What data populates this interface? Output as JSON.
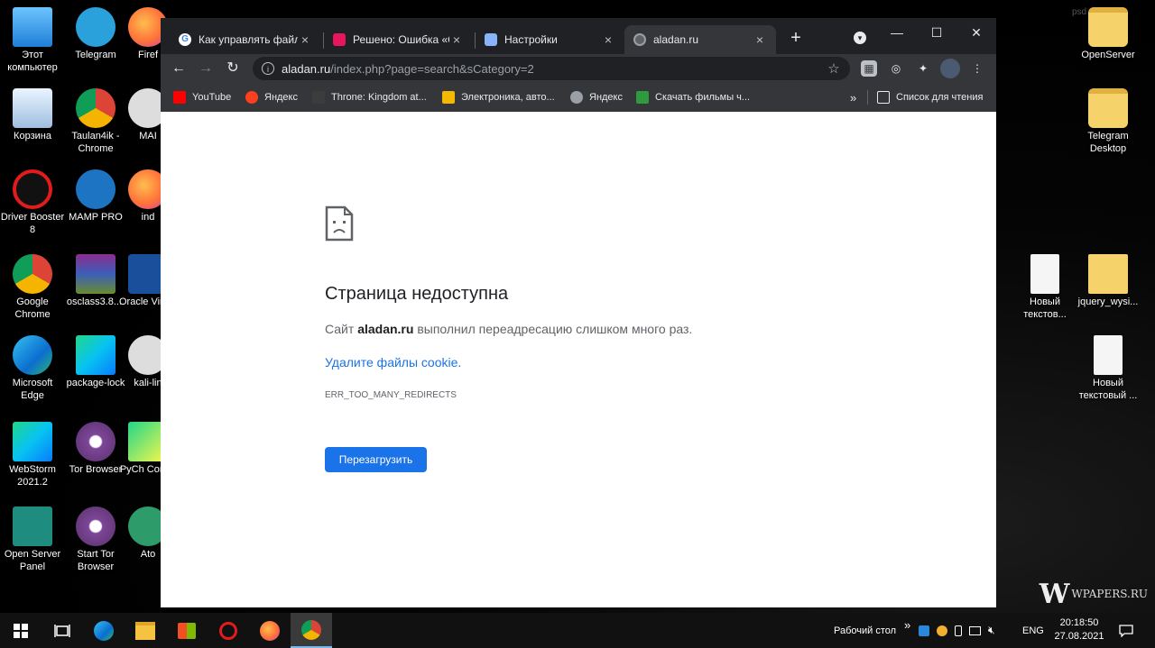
{
  "desktop": {
    "left_icons": [
      {
        "label": "Этот компьютер",
        "icon": "computer-icon"
      },
      {
        "label": "Telegram",
        "icon": "telegram-icon"
      },
      {
        "label": "Firef",
        "icon": "firefox-icon"
      },
      {
        "label": "Корзина",
        "icon": "recycle-bin-icon"
      },
      {
        "label": "Taulan4ik - Chrome",
        "icon": "chrome-profile-icon"
      },
      {
        "label": "MAI",
        "icon": "mamp-icon"
      },
      {
        "label": "Driver Booster 8",
        "icon": "driver-booster-icon"
      },
      {
        "label": "MAMP PRO",
        "icon": "mamp-pro-icon"
      },
      {
        "label": "ind",
        "icon": "firefox-icon"
      },
      {
        "label": "Google Chrome",
        "icon": "chrome-icon"
      },
      {
        "label": "osclass3.8....",
        "icon": "winrar-icon"
      },
      {
        "label": "Oracle Virtua",
        "icon": "virtualbox-icon"
      },
      {
        "label": "Microsoft Edge",
        "icon": "edge-icon"
      },
      {
        "label": "package-lock",
        "icon": "webstorm-icon"
      },
      {
        "label": "kali-lin",
        "icon": "kali-icon"
      },
      {
        "label": "WebStorm 2021.2",
        "icon": "webstorm-icon"
      },
      {
        "label": "Tor Browser",
        "icon": "tor-icon"
      },
      {
        "label": "PyCh Comm",
        "icon": "pycharm-icon"
      },
      {
        "label": "Open Server Panel",
        "icon": "terminal-icon"
      },
      {
        "label": "Start Tor Browser",
        "icon": "tor-icon"
      },
      {
        "label": "Ato",
        "icon": "atom-icon"
      }
    ],
    "right_icons": [
      {
        "label": "OpenServer",
        "icon": "folder-icon"
      },
      {
        "label": "Telegram Desktop",
        "icon": "folder-icon"
      },
      {
        "label": "Новый текстов...",
        "icon": "text-file-icon"
      },
      {
        "label": "jquery_wysi...",
        "icon": "vscode-icon"
      },
      {
        "label": "Новый текстовый ...",
        "icon": "text-file-icon"
      }
    ],
    "watermark": "WPAPERS.RU",
    "top_watermark": "psd"
  },
  "browser": {
    "tabs": [
      {
        "title": "Как управлять файла",
        "favicon": "google-icon",
        "color": "#ffffff"
      },
      {
        "title": "Решено: Ошибка «Сл",
        "favicon": "bookmark-red-icon",
        "color": "#e8175d"
      },
      {
        "title": "Настройки",
        "favicon": "settings-icon",
        "color": "#8ab4f8"
      },
      {
        "title": "aladan.ru",
        "favicon": "globe-icon",
        "color": "#9aa0a6"
      }
    ],
    "tab_close": "×",
    "new_tab": "+",
    "window_controls": {
      "minimize": "—",
      "maximize": "☐",
      "close": "✕"
    },
    "url_host": "aladan.ru",
    "url_rest": "/index.php?page=search&sCategory=2",
    "bookmarks": [
      {
        "label": "YouTube",
        "color": "#ff0000"
      },
      {
        "label": "Яндекс",
        "color": "#fc3f1d"
      },
      {
        "label": "Throne: Kingdom at...",
        "color": "#3c3c3c"
      },
      {
        "label": "Электроника, авто...",
        "color": "#f5b800"
      },
      {
        "label": "Яндекс",
        "color": "#9aa0a6"
      },
      {
        "label": "Скачать фильмы ч...",
        "color": "#2e9b3f"
      }
    ],
    "bookmarks_overflow": "»",
    "reading_list": "Список для чтения"
  },
  "error_page": {
    "title": "Страница недоступна",
    "desc_prefix": "Сайт ",
    "desc_host": "aladan.ru",
    "desc_suffix": " выполнил переадресацию слишком много раз.",
    "link": "Удалите файлы cookie.",
    "code": "ERR_TOO_MANY_REDIRECTS",
    "reload_button": "Перезагрузить"
  },
  "taskbar": {
    "desktop_label": "Рабочий стол",
    "overflow": "»",
    "language": "ENG",
    "time": "20:18:50",
    "date": "27.08.2021"
  },
  "colors": {
    "accent": "#1a73e8",
    "tab_bar": "#202124",
    "toolbar": "#35363a"
  }
}
